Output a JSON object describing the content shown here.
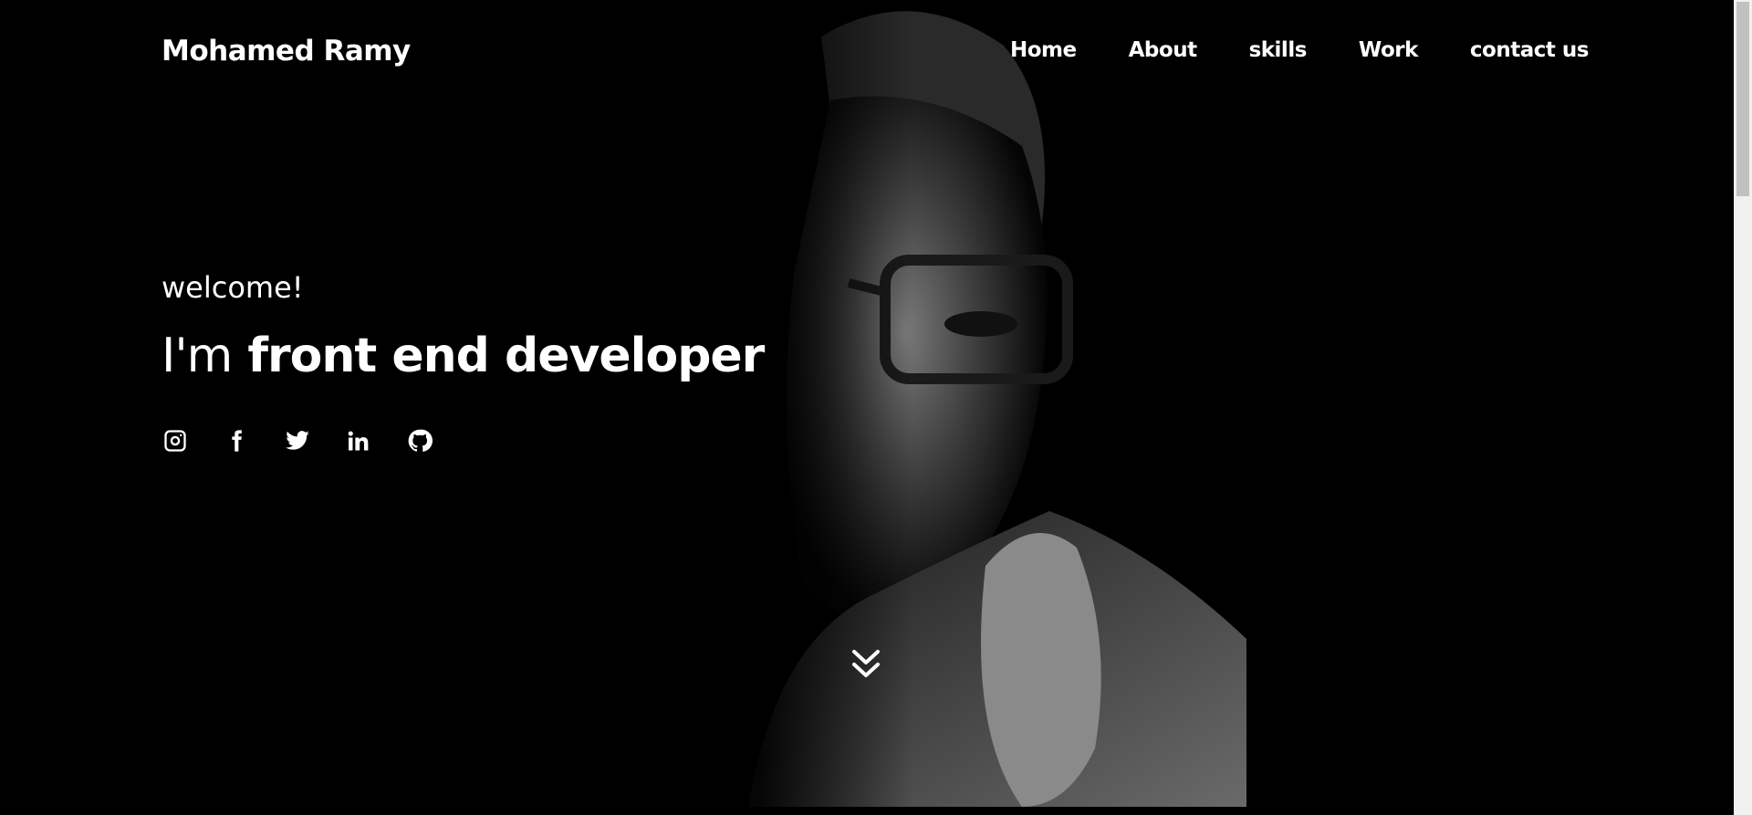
{
  "brand": {
    "name": "Mohamed Ramy"
  },
  "nav": {
    "items": [
      "Home",
      "About",
      "skills",
      "Work",
      "contact us"
    ]
  },
  "hero": {
    "welcome": "welcome!",
    "headline_prefix": "I'm",
    "headline_strong": "front end developer"
  },
  "socials": [
    {
      "icon": "instagram-icon"
    },
    {
      "icon": "facebook-icon"
    },
    {
      "icon": "twitter-icon"
    },
    {
      "icon": "linkedin-icon"
    },
    {
      "icon": "github-icon"
    }
  ],
  "scroll": {
    "icon": "double-chevron-down-icon"
  },
  "colors": {
    "background": "#000000",
    "text": "#ffffff",
    "scrollbar_track": "#f1f1f1",
    "scrollbar_thumb": "#c1c1c1"
  }
}
